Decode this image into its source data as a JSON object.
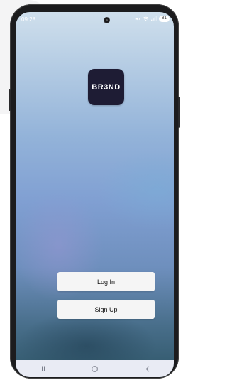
{
  "status_bar": {
    "time": "09:28",
    "battery": "81",
    "icons": [
      "mute-icon",
      "wifi-icon",
      "signal-icon",
      "battery-icon"
    ]
  },
  "app": {
    "logo_text": "BR3ND",
    "logo_bg_color": "#1e1c34"
  },
  "actions": {
    "login_label": "Log In",
    "signup_label": "Sign Up"
  },
  "nav_bar": {
    "buttons": [
      "recent-apps-icon",
      "home-icon",
      "back-icon"
    ]
  }
}
